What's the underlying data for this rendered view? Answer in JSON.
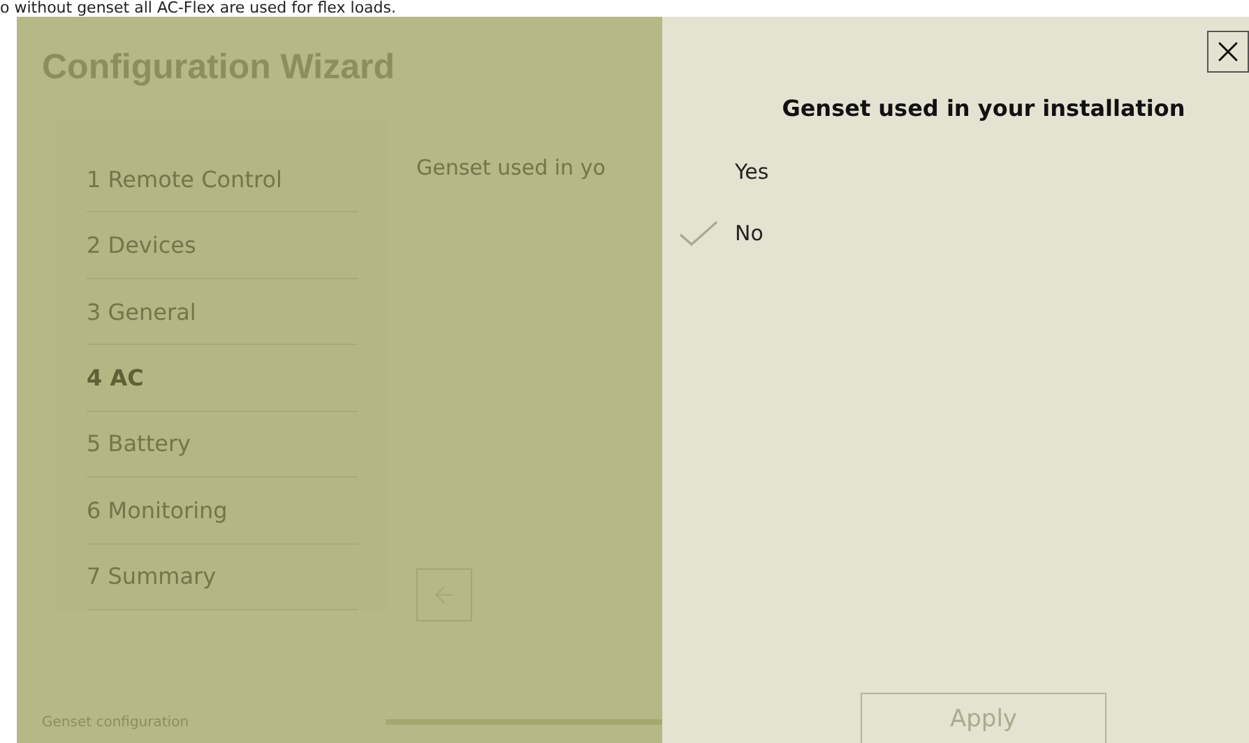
{
  "top_text": "o without genset all AC-Flex are used for flex loads.",
  "wizard": {
    "title": "Configuration Wizard",
    "steps": [
      {
        "label": "1 Remote Control",
        "selected": false
      },
      {
        "label": "2 Devices",
        "selected": false
      },
      {
        "label": "3 General",
        "selected": false
      },
      {
        "label": "4 AC",
        "selected": true
      },
      {
        "label": "5 Battery",
        "selected": false
      },
      {
        "label": "6 Monitoring",
        "selected": false
      },
      {
        "label": "7 Summary",
        "selected": false
      }
    ],
    "content_label": "Genset used in yo",
    "footer_label": "Genset configuration"
  },
  "dialog": {
    "title": "Genset used in your installation",
    "options": [
      {
        "label": "Yes",
        "selected": false
      },
      {
        "label": "No",
        "selected": true
      }
    ],
    "apply_button": {
      "label": "Apply",
      "disabled": true
    }
  }
}
